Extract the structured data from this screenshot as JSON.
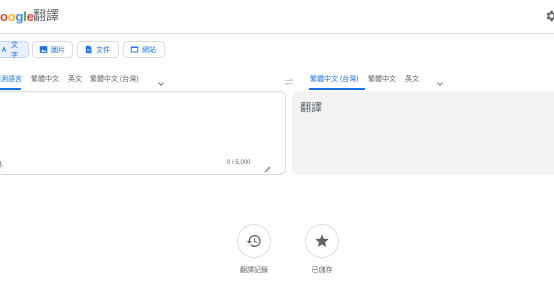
{
  "header": {
    "logo_text": "oogle",
    "app_title": "翻譯"
  },
  "modes": [
    {
      "label": "文字",
      "icon": "text-icon",
      "active": true
    },
    {
      "label": "圖片",
      "icon": "image-icon",
      "active": false
    },
    {
      "label": "文件",
      "icon": "document-icon",
      "active": false
    },
    {
      "label": "網站",
      "icon": "website-icon",
      "active": false
    }
  ],
  "source_languages": [
    "偵測語言",
    "繁體中文",
    "英文",
    "繁體中文 (台灣)"
  ],
  "target_languages": [
    "繁體中文 (台灣)",
    "繁體中文",
    "英文"
  ],
  "target": {
    "placeholder_text": "翻譯"
  },
  "source": {
    "char_count": "0 / 5,000"
  },
  "actions": [
    {
      "label": "翻譯記錄",
      "icon": "history-icon"
    },
    {
      "label": "已儲存",
      "icon": "star-icon"
    }
  ],
  "colors": {
    "accent": "#1a73e8",
    "panel_bg": "#f1f3f4",
    "text_muted": "#5f6368"
  }
}
